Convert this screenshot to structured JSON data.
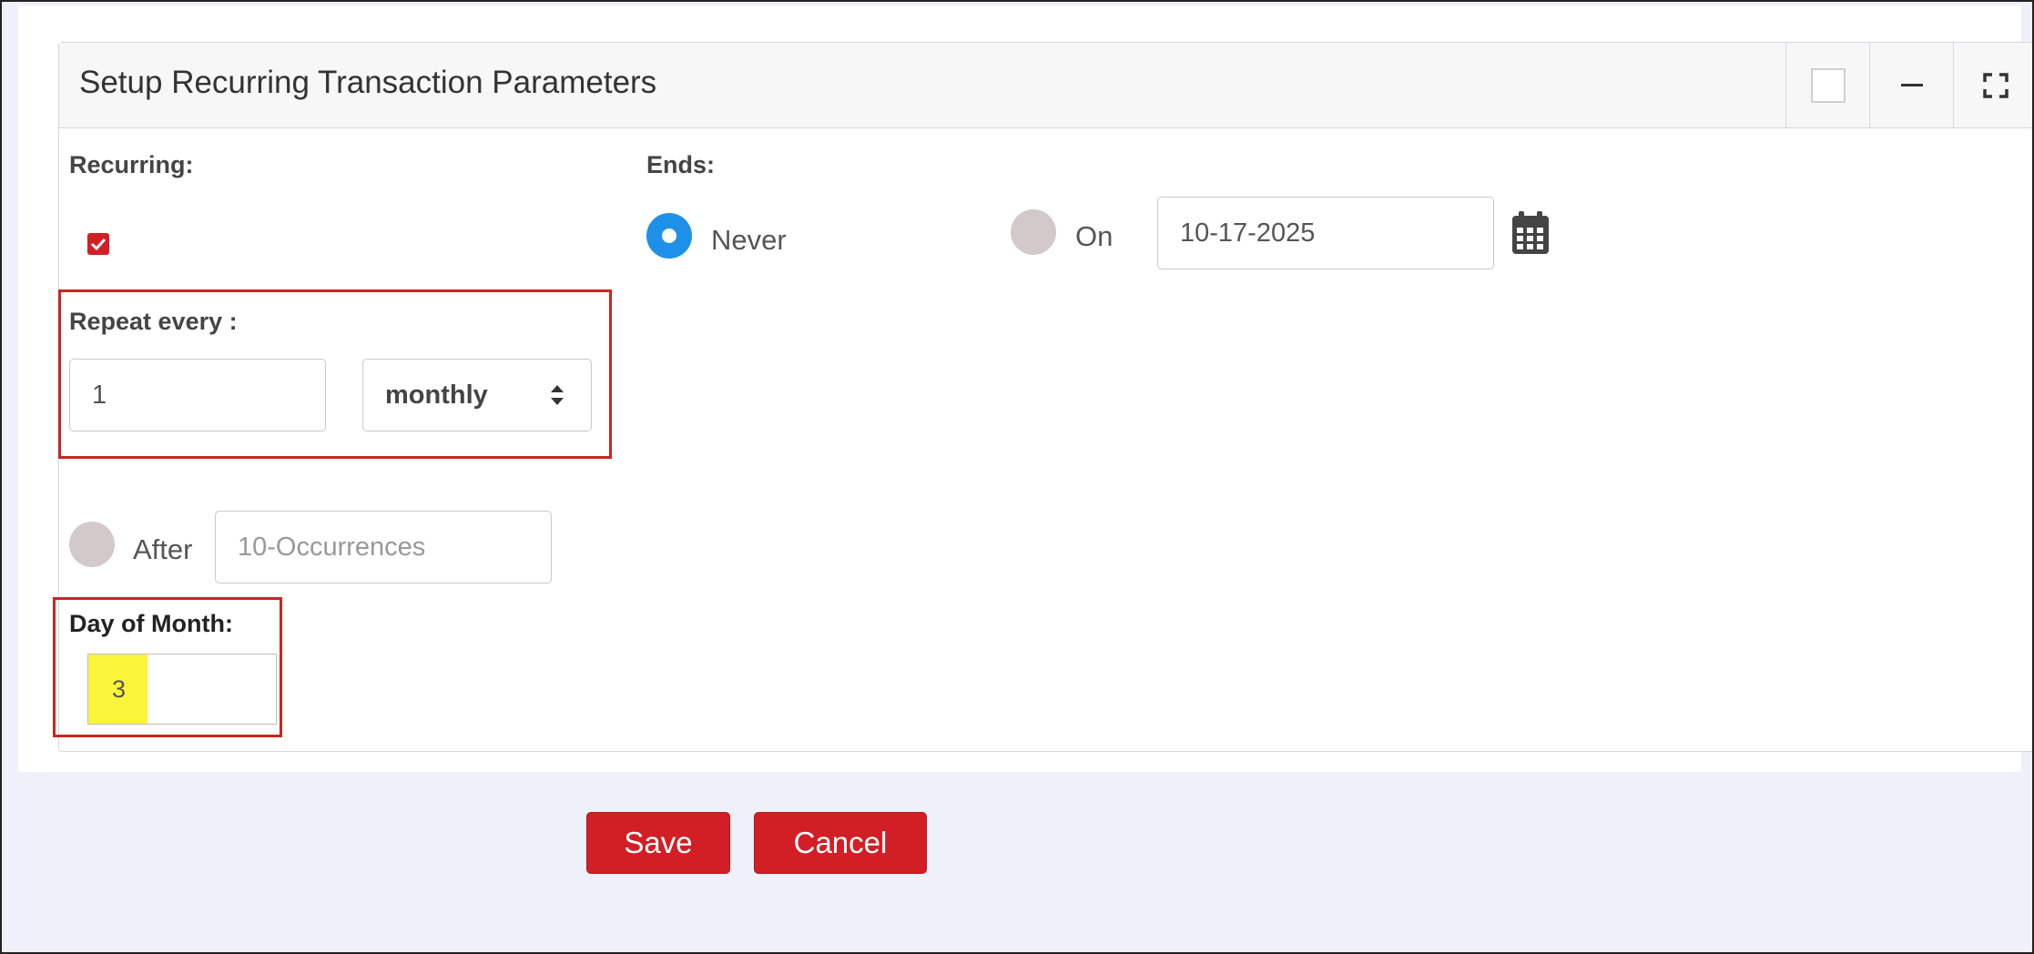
{
  "panel": {
    "title": "Setup Recurring Transaction Parameters",
    "header_buttons": [
      "square-icon",
      "minimize-icon",
      "fullscreen-icon"
    ]
  },
  "recurring": {
    "label": "Recurring:",
    "checked": true
  },
  "repeat": {
    "label": "Repeat every :",
    "interval": "1",
    "frequency": "monthly"
  },
  "ends": {
    "label": "Ends:",
    "never_label": "Never",
    "on_label": "On",
    "on_date": "10-17-2025",
    "after_label": "After",
    "after_placeholder": "10-Occurrences",
    "selected": "never"
  },
  "day_of_month": {
    "label": "Day of Month:",
    "value": "3"
  },
  "actions": {
    "save_label": "Save",
    "cancel_label": "Cancel"
  },
  "colors": {
    "accent_red": "#d11f25",
    "radio_blue": "#1e90e8",
    "highlight_yellow": "#fbf53a"
  }
}
